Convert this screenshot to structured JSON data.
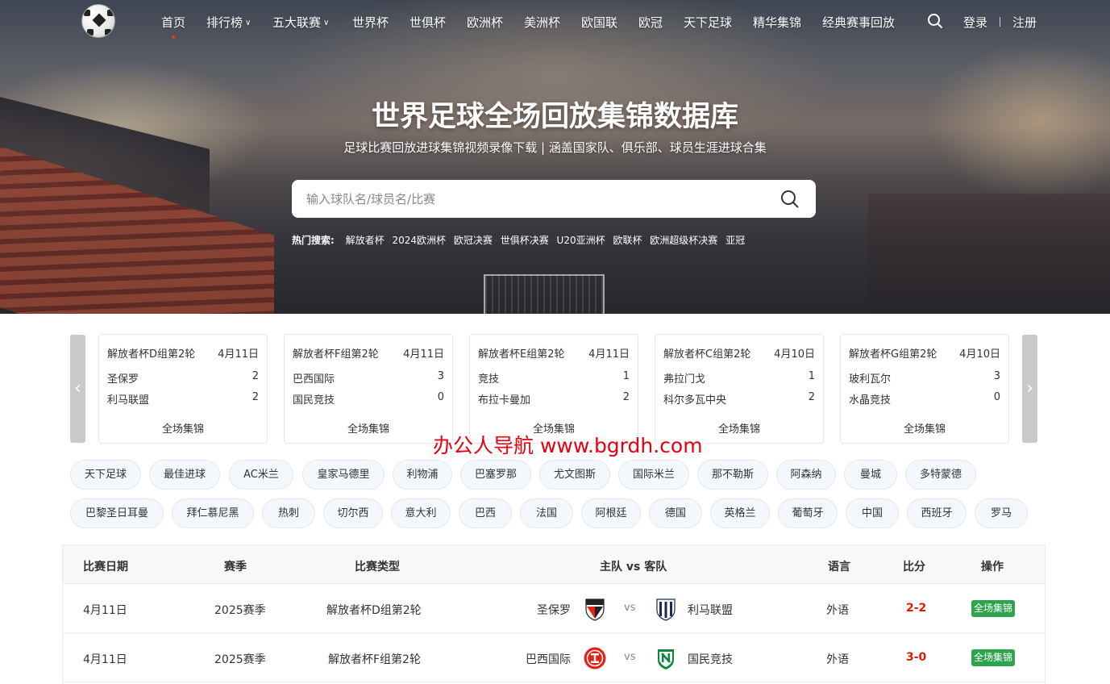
{
  "nav": {
    "items": [
      "首页",
      "排行榜",
      "五大联赛",
      "世界杯",
      "世俱杯",
      "欧洲杯",
      "美洲杯",
      "欧国联",
      "欧冠",
      "天下足球",
      "精华集锦",
      "经典赛事回放"
    ],
    "login": "登录",
    "register": "注册"
  },
  "hero": {
    "title": "世界足球全场回放集锦数据库",
    "subtitle": "足球比赛回放进球集锦视频录像下载 | 涵盖国家队、俱乐部、球员生涯进球合集",
    "search_placeholder": "输入球队名/球员名/比赛",
    "hot_label": "热门搜索:",
    "hot_items": [
      "解放者杯",
      "2024欧洲杯",
      "欧冠决赛",
      "世俱杯决赛",
      "U20亚洲杯",
      "欧联杯",
      "欧洲超级杯决赛",
      "亚冠"
    ]
  },
  "cards": [
    {
      "league": "解放者杯D组第2轮",
      "date": "4月11日",
      "home": "圣保罗",
      "home_score": "2",
      "away": "利马联盟",
      "away_score": "2",
      "button": "全场集锦"
    },
    {
      "league": "解放者杯F组第2轮",
      "date": "4月11日",
      "home": "巴西国际",
      "home_score": "3",
      "away": "国民竞技",
      "away_score": "0",
      "button": "全场集锦"
    },
    {
      "league": "解放者杯E组第2轮",
      "date": "4月11日",
      "home": "竞技",
      "home_score": "1",
      "away": "布拉卡曼加",
      "away_score": "2",
      "button": "全场集锦"
    },
    {
      "league": "解放者杯C组第2轮",
      "date": "4月10日",
      "home": "弗拉门戈",
      "home_score": "1",
      "away": "科尔多瓦中央",
      "away_score": "2",
      "button": "全场集锦"
    },
    {
      "league": "解放者杯G组第2轮",
      "date": "4月10日",
      "home": "玻利瓦尔",
      "home_score": "3",
      "away": "水晶竞技",
      "away_score": "0",
      "button": "全场集锦"
    }
  ],
  "carousel": {
    "prev": "‹",
    "next": "›"
  },
  "watermark": "办公人导航 www.bgrdh.com",
  "tags_row1": [
    "天下足球",
    "最佳进球",
    "AC米兰",
    "皇家马德里",
    "利物浦",
    "巴塞罗那",
    "尤文图斯",
    "国际米兰",
    "那不勒斯",
    "阿森纳",
    "曼城",
    "多特蒙德"
  ],
  "tags_row2": [
    "巴黎圣日耳曼",
    "拜仁慕尼黑",
    "热刺",
    "切尔西",
    "意大利",
    "巴西",
    "法国",
    "阿根廷",
    "德国",
    "英格兰",
    "葡萄牙",
    "中国",
    "西班牙",
    "罗马"
  ],
  "table": {
    "headers": [
      "比赛日期",
      "赛季",
      "比赛类型",
      "主队 vs 客队",
      "语言",
      "比分",
      "操作"
    ],
    "rows": [
      {
        "date": "4月11日",
        "season": "2025赛季",
        "type": "解放者杯D组第2轮",
        "home": "圣保罗",
        "vs": "vs",
        "away": "利马联盟",
        "lang": "外语",
        "score": "2-2",
        "action": "全场集锦"
      },
      {
        "date": "4月11日",
        "season": "2025赛季",
        "type": "解放者杯F组第2轮",
        "home": "巴西国际",
        "vs": "vs",
        "away": "国民竞技",
        "lang": "外语",
        "score": "3-0",
        "action": "全场集锦"
      }
    ]
  },
  "colors": {
    "accent_red": "#e63b2e",
    "score_red": "#d81e06",
    "action_green": "#2ea44f",
    "tag_bg": "#f4f7fb"
  },
  "icons": {
    "search": "search-icon",
    "logo": "soccer-ball-logo"
  }
}
